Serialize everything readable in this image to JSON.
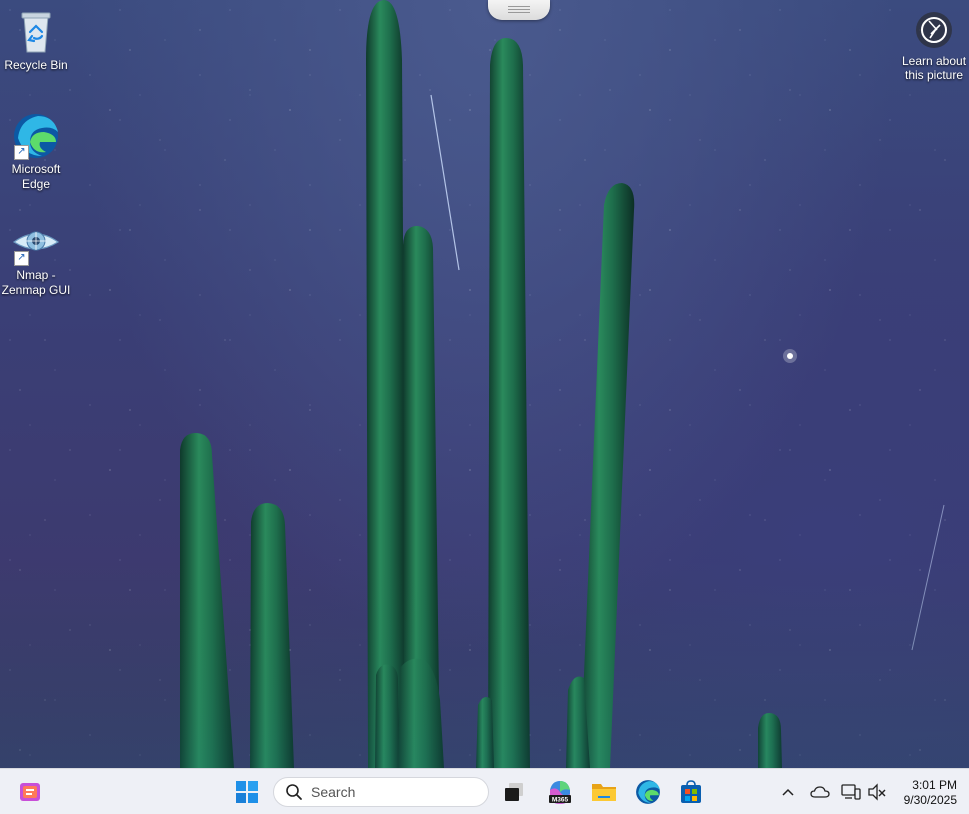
{
  "desktop": {
    "icons": [
      {
        "label": "Recycle Bin",
        "icon": "recycle-bin-icon"
      },
      {
        "label": "Microsoft Edge",
        "icon": "edge-icon"
      },
      {
        "label": "Nmap - Zenmap GUI",
        "icon": "zenmap-icon"
      }
    ],
    "learn_about": {
      "label": "Learn about this picture",
      "icon": "camera-lens-icon"
    }
  },
  "taskbar": {
    "search_placeholder": "Search",
    "apps": [
      "widgets-icon",
      "start-windows-icon",
      "task-view-icon",
      "m365-copilot-icon",
      "file-explorer-icon",
      "edge-icon",
      "store-icon"
    ],
    "m365_badge": "M365",
    "tray": [
      "chevron-up-icon",
      "onedrive-cloud-icon",
      "network-icon",
      "volume-muted-icon"
    ],
    "time": "3:01 PM",
    "date": "9/30/2025"
  },
  "colors": {
    "taskbar_bg": "#eef0f6",
    "sky": "#3b4479",
    "cactus": "#1f6b4e"
  }
}
